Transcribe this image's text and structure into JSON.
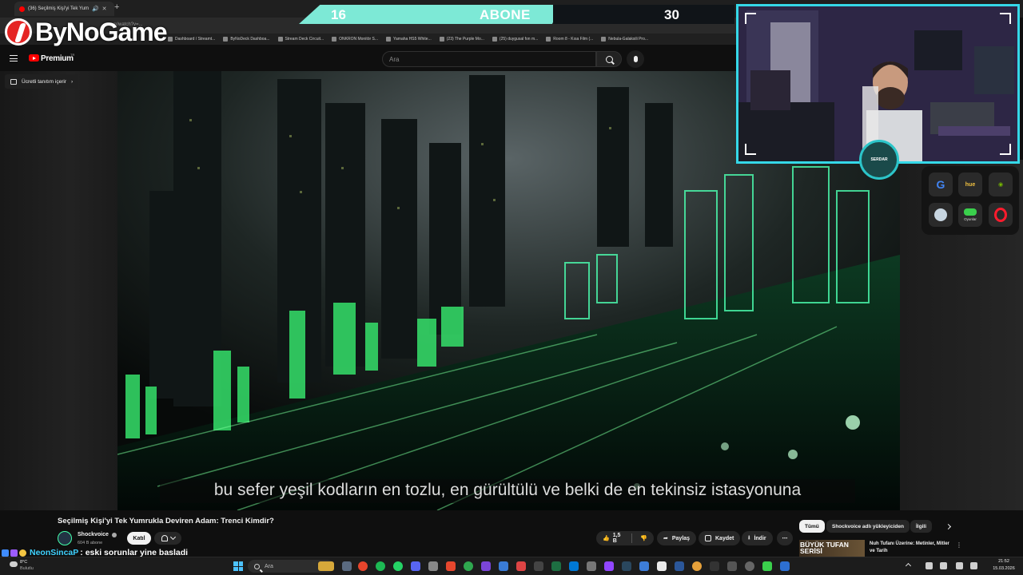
{
  "browser": {
    "tab_title": "(36) Seçilmiş Kişi'yi Tek Yum",
    "new_tab_icon": "plus-icon",
    "url_fragment": "e.com/watch?v=...",
    "bookmarks": [
      "Dashboard / Streamt...",
      "ByNoDeck Dashboa...",
      "Stream Deck Circuit...",
      "ONKRON Monitör S...",
      "Yamaha HS5 White...",
      "(23) The Purple Mo...",
      "(25) duygusal fon m...",
      "Room 8 - Kısa Film (...",
      "Nebula-Galaksili Pro..."
    ]
  },
  "overlay": {
    "logo_text": "ByNoGame",
    "subs_current": "16",
    "subs_label": "ABONE",
    "subs_goal": "30",
    "badge_text": "SERDAR",
    "colors": {
      "bar": "#7de9d6",
      "cam_border": "#35d8e8",
      "logo_red": "#e52524"
    }
  },
  "youtube": {
    "brand": "Premium",
    "brand_region": "TR",
    "search_placeholder": "Ara",
    "promo_label": "Ücretli tanıtım içerir",
    "subtitle": "bu sefer yeşil kodların en tozlu, en gürültülü ve belki de en tekinsiz istasyonuna",
    "video_title": "Seçilmiş Kişi'yi Tek Yumrukla Deviren Adam: Trenci Kimdir?",
    "channel_name": "Shockvoice",
    "channel_subs": "604 B abone",
    "join_label": "Katıl",
    "like_count": "1,5 B",
    "share_label": "Paylaş",
    "save_label": "Kaydet",
    "download_label": "İndir",
    "chips": [
      "Tümü",
      "Shockvoice adlı yükleyiciden",
      "İlgili"
    ],
    "rec": {
      "thumb_text": "BÜYÜK TUFAN SERİSİ",
      "title": "Nuh Tufanı Üzerine: Metinler, Mitler ve Tarih"
    }
  },
  "dock": {
    "apps": [
      "google-icon",
      "hue-icon",
      "nvidia-icon",
      "steam-icon",
      "gamepad-icon",
      "opera-icon"
    ],
    "hue_label": "hue",
    "oyunlar_label": "Oyunlar"
  },
  "chat": {
    "user": "NeonSincaP",
    "message": ": eski sorunlar yine basladi"
  },
  "taskbar": {
    "weather_temp": "8°C",
    "weather_desc": "Bulutlu",
    "search_placeholder": "Ara",
    "time": "21:52",
    "date": "15.03.2026"
  }
}
